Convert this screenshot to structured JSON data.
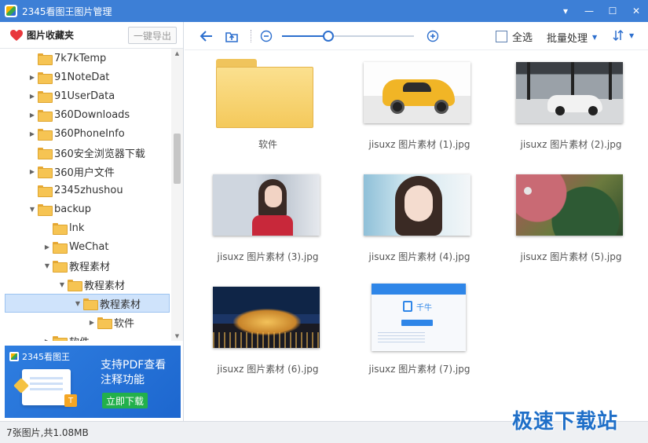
{
  "window": {
    "title": "2345看图王图片管理",
    "controls": [
      "▾",
      "—",
      "☐",
      "✕"
    ]
  },
  "sidebar": {
    "title": "图片收藏夹",
    "export_label": "一键导出",
    "tree": [
      {
        "label": "7k7kTemp",
        "depth": 0,
        "arrow": ""
      },
      {
        "label": "91NoteDat",
        "depth": 0,
        "arrow": "▶"
      },
      {
        "label": "91UserData",
        "depth": 0,
        "arrow": "▶"
      },
      {
        "label": "360Downloads",
        "depth": 0,
        "arrow": "▶"
      },
      {
        "label": "360PhoneInfo",
        "depth": 0,
        "arrow": "▶"
      },
      {
        "label": "360安全浏览器下载",
        "depth": 0,
        "arrow": ""
      },
      {
        "label": "360用户文件",
        "depth": 0,
        "arrow": "▶"
      },
      {
        "label": "2345zhushou",
        "depth": 0,
        "arrow": ""
      },
      {
        "label": "backup",
        "depth": 0,
        "arrow": "▼"
      },
      {
        "label": "lnk",
        "depth": 1,
        "arrow": ""
      },
      {
        "label": "WeChat",
        "depth": 1,
        "arrow": "▶"
      },
      {
        "label": "教程素材",
        "depth": 1,
        "arrow": "▼"
      },
      {
        "label": "教程素材",
        "depth": 2,
        "arrow": "▼"
      },
      {
        "label": "教程素材",
        "depth": 3,
        "arrow": "▼",
        "selected": true
      },
      {
        "label": "软件",
        "depth": 4,
        "arrow": "▶"
      },
      {
        "label": "软件",
        "depth": 1,
        "arrow": "▶"
      }
    ]
  },
  "ad": {
    "brand": "2345看图王",
    "line1": "支持PDF查看",
    "line2": "注释功能",
    "button": "立即下载"
  },
  "toolbar": {
    "select_all": "全选",
    "batch": "批量处理",
    "zoom_level": 0.35
  },
  "grid": {
    "items": [
      {
        "label": "软件",
        "kind": "folder"
      },
      {
        "label": "jisuxz 图片素材 (1).jpg",
        "kind": "car-yellow"
      },
      {
        "label": "jisuxz 图片素材 (2).jpg",
        "kind": "car-white"
      },
      {
        "label": "jisuxz 图片素材 (3).jpg",
        "kind": "portrait-red"
      },
      {
        "label": "jisuxz 图片素材 (4).jpg",
        "kind": "portrait"
      },
      {
        "label": "jisuxz 图片素材 (5).jpg",
        "kind": "aerial"
      },
      {
        "label": "jisuxz 图片素材 (6).jpg",
        "kind": "castle-night"
      },
      {
        "label": "jisuxz 图片素材 (7).jpg",
        "kind": "screenshot"
      }
    ],
    "shot_brand": "千牛"
  },
  "status": {
    "text": "7张图片,共1.08MB"
  },
  "watermark": "极速下载站",
  "colors": {
    "titlebar": "#3d7fd6",
    "accent": "#2d6fce",
    "selected_bg": "#cfe3fb"
  }
}
